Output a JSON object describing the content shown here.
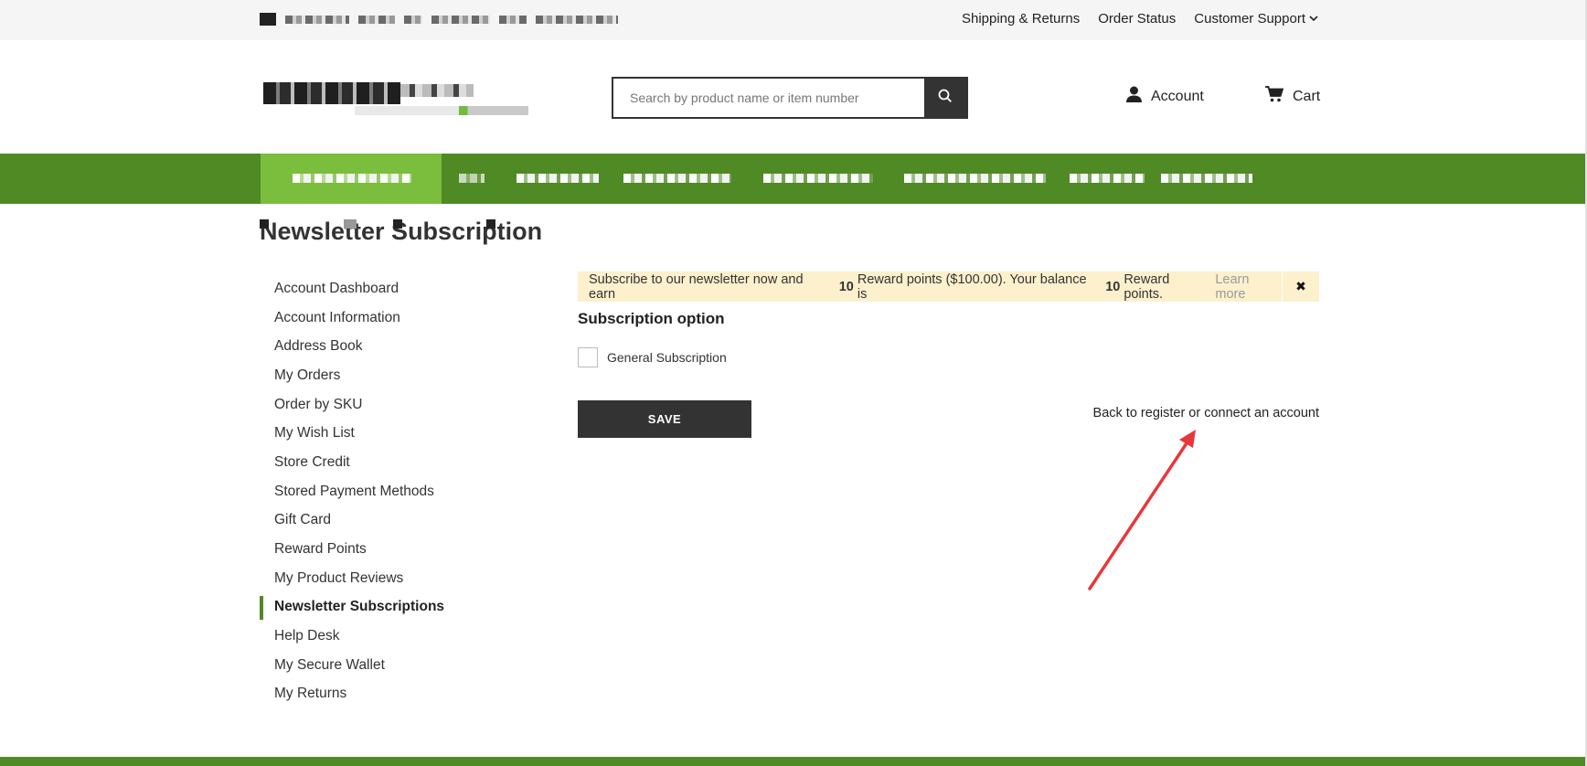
{
  "topbar": {
    "links": [
      "Shipping & Returns",
      "Order Status",
      "Customer Support"
    ]
  },
  "search": {
    "placeholder": "Search by product name or item number"
  },
  "header": {
    "account_label": "Account",
    "cart_label": "Cart"
  },
  "page": {
    "title": "Newsletter Subscription"
  },
  "sidebar": {
    "items": [
      "Account Dashboard",
      "Account Information",
      "Address Book",
      "My Orders",
      "Order by SKU",
      "My Wish List",
      "Store Credit",
      "Stored Payment Methods",
      "Gift Card",
      "Reward Points",
      "My Product Reviews",
      "Newsletter Subscriptions",
      "Help Desk",
      "My Secure Wallet",
      "My Returns"
    ],
    "active_index": 11
  },
  "notice": {
    "text_before": "Subscribe to our newsletter now and earn",
    "points": "10",
    "text_middle": "Reward points ($100.00). Your balance is",
    "balance": "10",
    "text_after": "Reward points.",
    "learn_more": "Learn more",
    "close": "✖"
  },
  "subscription": {
    "heading": "Subscription option",
    "option_label": "General Subscription",
    "checked": false
  },
  "actions": {
    "save_label": "SAVE",
    "back_link": "Back to register or connect an account"
  },
  "colors": {
    "nav_green": "#4f8a25",
    "nav_active": "#7bbd3d",
    "notice_bg": "#fdf0cd",
    "button_dark": "#333333",
    "annotation_arrow": "#e8373b"
  },
  "icons": {
    "search": "search-icon",
    "account": "user-icon",
    "cart": "cart-icon",
    "close": "close-icon",
    "chevron": "chevron-down-icon"
  }
}
